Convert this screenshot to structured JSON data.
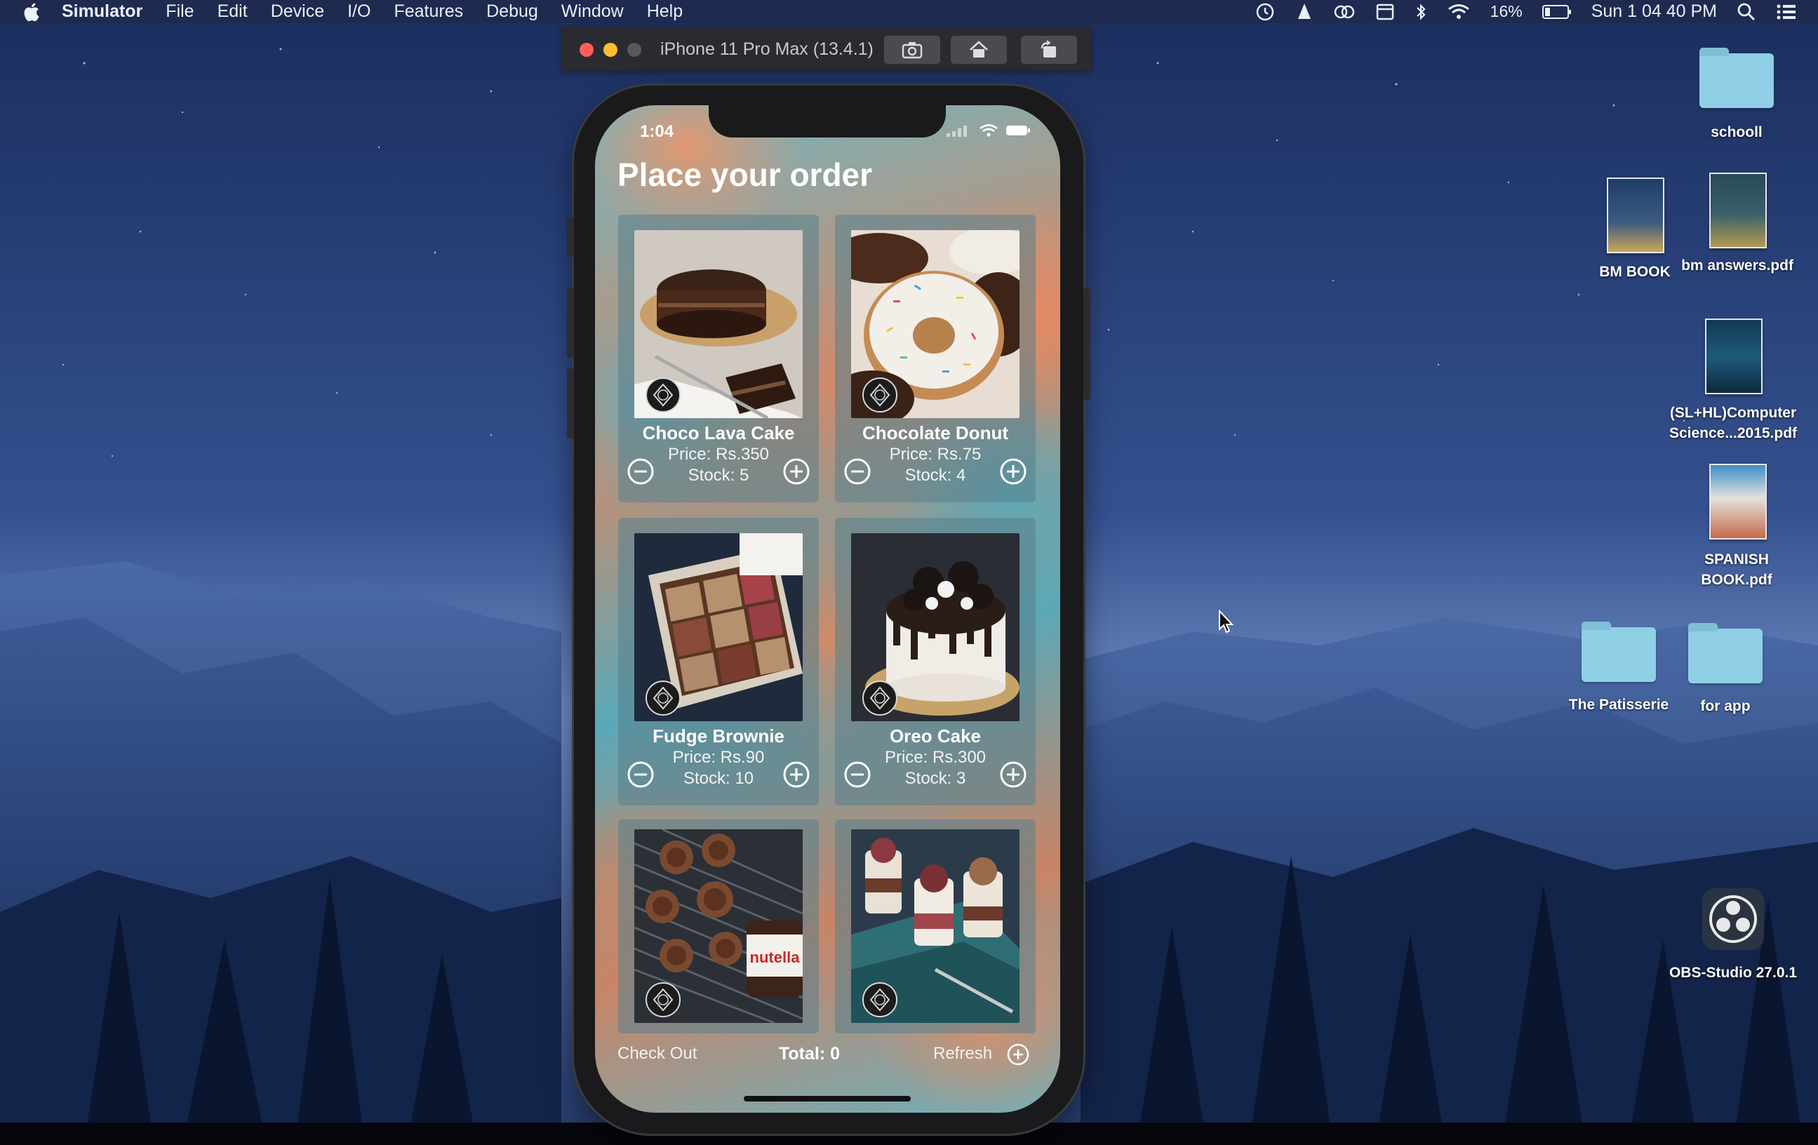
{
  "menubar": {
    "app_name": "Simulator",
    "items": [
      "File",
      "Edit",
      "Device",
      "I/O",
      "Features",
      "Debug",
      "Window",
      "Help"
    ],
    "battery_percent": "16%",
    "clock": "Sun 1 04 40 PM"
  },
  "simulator_window": {
    "title": "iPhone 11 Pro Max (13.4.1)",
    "buttons": [
      "camera-icon",
      "home-icon",
      "rotate-icon"
    ]
  },
  "phone": {
    "status_time": "1:04",
    "page_title": "Place your order",
    "products": [
      {
        "name": "Choco Lava Cake",
        "price": "Price: Rs.350",
        "stock": "Stock: 5"
      },
      {
        "name": "Chocolate Donut",
        "price": "Price: Rs.75",
        "stock": "Stock: 4"
      },
      {
        "name": "Fudge Brownie",
        "price": "Price: Rs.90",
        "stock": "Stock: 10"
      },
      {
        "name": "Oreo Cake",
        "price": "Price: Rs.300",
        "stock": "Stock: 3"
      },
      {
        "name": "",
        "price": "",
        "stock": ""
      },
      {
        "name": "",
        "price": "",
        "stock": ""
      }
    ],
    "bottom_bar": {
      "checkout_label": "Check Out",
      "total_label": "Total: 0",
      "refresh_label": "Refresh"
    }
  },
  "desktop_icons": [
    {
      "label": "schooll",
      "kind": "folder"
    },
    {
      "label": "BM BOOK",
      "kind": "document"
    },
    {
      "label": "bm answers.pdf",
      "kind": "document"
    },
    {
      "label_line1": "(SL+HL)Computer",
      "label_line2": "Science...2015.pdf",
      "kind": "document"
    },
    {
      "label_line1": "SPANISH",
      "label_line2": "BOOK.pdf",
      "kind": "document"
    },
    {
      "label": "The Patisserie",
      "kind": "folder"
    },
    {
      "label": "for app",
      "kind": "folder"
    },
    {
      "label": "OBS-Studio 27.0.1",
      "kind": "application"
    }
  ],
  "colors": {
    "menubar_bg": "#1e2a4e",
    "folder": "#8fd0e6",
    "close": "#ff5f57",
    "minimize": "#febc2e",
    "zoom": "#58585c"
  }
}
